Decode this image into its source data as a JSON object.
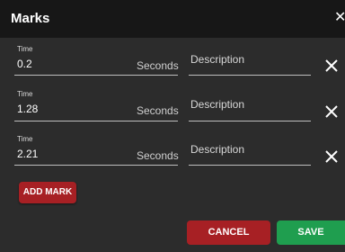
{
  "dialog": {
    "title": "Marks",
    "close_icon": "close-icon"
  },
  "marks": [
    {
      "time_label": "Time",
      "time_value": "0.2",
      "unit": "Seconds",
      "description_placeholder": "Description"
    },
    {
      "time_label": "Time",
      "time_value": "1.28",
      "unit": "Seconds",
      "description_placeholder": "Description"
    },
    {
      "time_label": "Time",
      "time_value": "2.21",
      "unit": "Seconds",
      "description_placeholder": "Description"
    }
  ],
  "actions": {
    "add_mark_label": "ADD MARK",
    "cancel_label": "CANCEL",
    "save_label": "SAVE"
  },
  "colors": {
    "titlebar": "#171717",
    "body": "#2c2c2c",
    "danger": "#a72024",
    "success": "#1f9e4f"
  }
}
